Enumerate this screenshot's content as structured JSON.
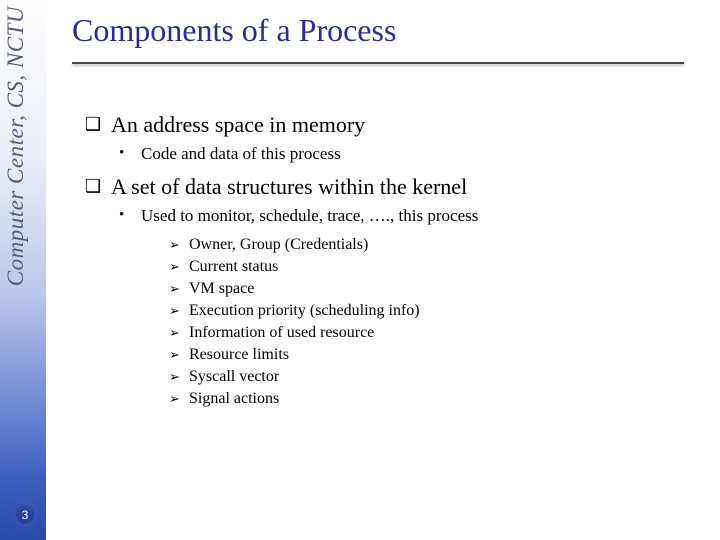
{
  "sidebar": {
    "label": "Computer Center, CS, NCTU"
  },
  "page_number": "3",
  "title": "Components of a Process",
  "body": {
    "item1": {
      "text": "An address space in memory",
      "sub1": "Code and data of this process"
    },
    "item2": {
      "text": "A set of data structures within the kernel",
      "sub1": "Used to monitor, schedule, trace, …., this process",
      "points": [
        "Owner, Group (Credentials)",
        "Current status",
        "VM space",
        "Execution priority (scheduling info)",
        "Information of used resource",
        "Resource limits",
        "Syscall vector",
        "Signal actions"
      ]
    }
  }
}
